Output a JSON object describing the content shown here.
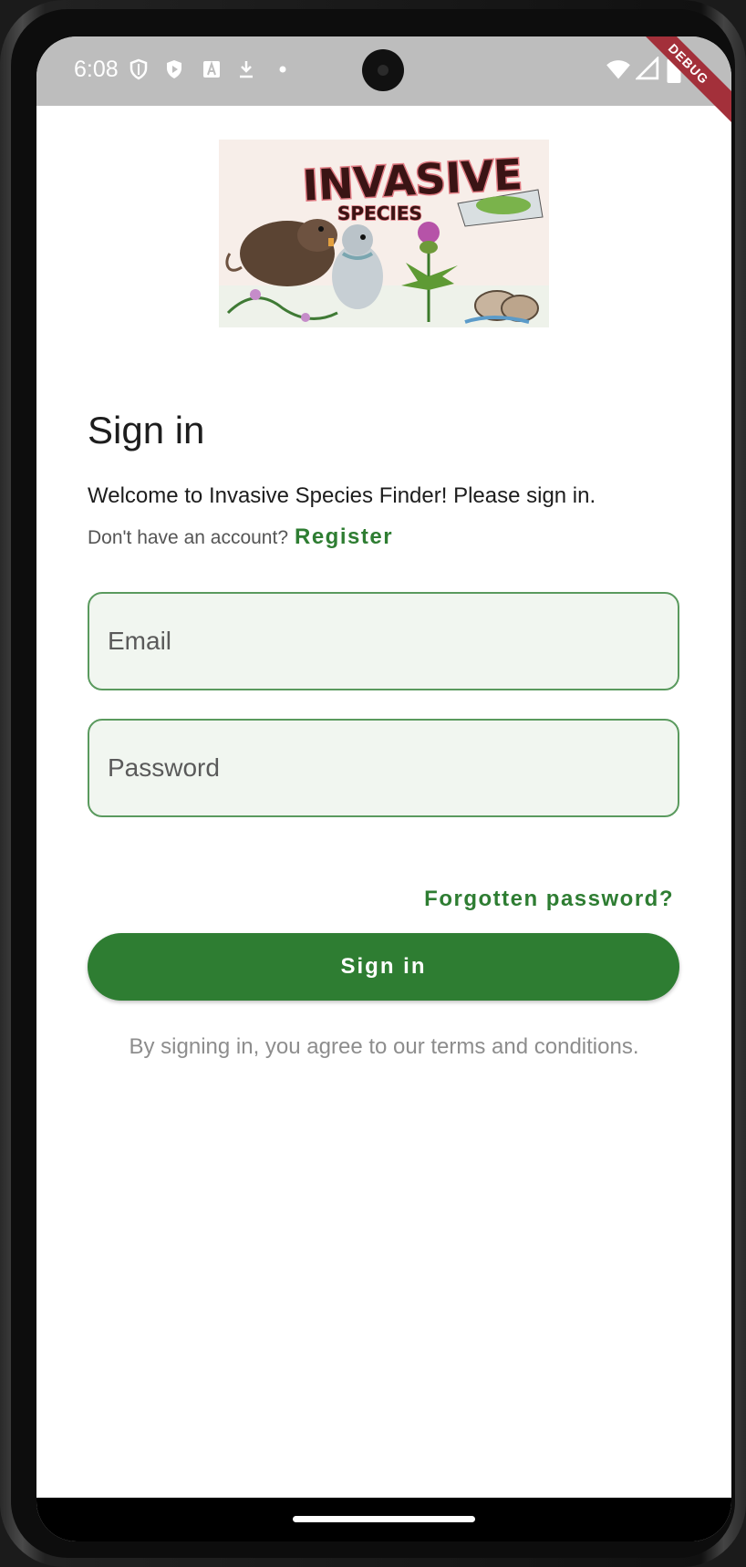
{
  "status_bar": {
    "time": "6:08",
    "icons": [
      "shield-icon",
      "play-shield-icon",
      "a-square-icon",
      "download-icon",
      "dot-icon"
    ],
    "right_icons": [
      "wifi-icon",
      "signal-icon",
      "battery-icon"
    ],
    "debug_label": "DEBUG"
  },
  "logo": {
    "name": "invasive-species-logo",
    "text": "INVASIVE SPECIES"
  },
  "signin": {
    "title": "Sign in",
    "welcome": "Welcome to Invasive Species Finder! Please sign in.",
    "no_account": "Don't have an account?",
    "register_label": "Register",
    "email_placeholder": "Email",
    "password_placeholder": "Password",
    "forgot_label": "Forgotten password?",
    "button_label": "Sign in",
    "terms": "By signing in, you agree to our terms and conditions."
  },
  "colors": {
    "accent": "#2e7d32",
    "field_fill": "#f1f6f0",
    "field_border": "#5a9a5e",
    "status_bar": "#bdbdbd"
  }
}
